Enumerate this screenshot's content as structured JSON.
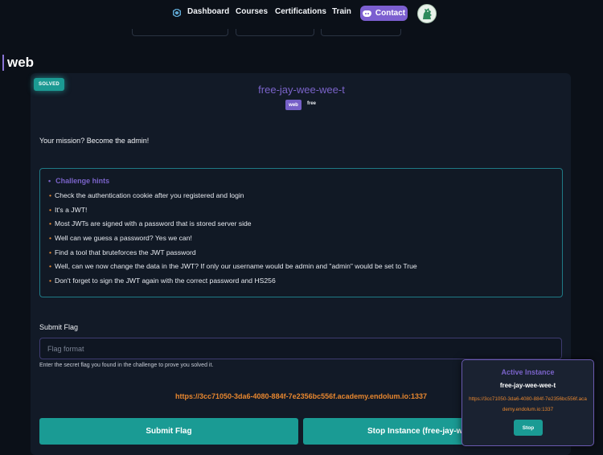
{
  "nav": {
    "items": [
      "Dashboard",
      "Courses",
      "Certifications",
      "Train"
    ],
    "contact_label": "Contact",
    "icons": {
      "logo": "hexagon-icon",
      "contact": "discord-icon",
      "avatar": "dragon-avatar"
    }
  },
  "category": {
    "title": "web"
  },
  "challenge": {
    "solved_badge": "SOLVED",
    "title": "free-jay-wee-wee-t",
    "tags": [
      "web",
      "free"
    ],
    "mission": "Your mission? Become the admin!",
    "hints_title": "Challenge hints",
    "hints": [
      "Check the authentication cookie after you registered and login",
      "It's a JWT!",
      "Most JWTs are signed with a password that is stored server side",
      "Well can we guess a password? Yes we can!",
      "Find a tool that bruteforces the JWT password",
      "Well, can we now change the data in the JWT? If only our username would be admin and \"admin\" would be set to True",
      "Don't forget to sign the JWT again with the correct password and HS256"
    ]
  },
  "flag_form": {
    "label": "Submit Flag",
    "placeholder": "Flag format",
    "value": "",
    "help": "Enter the secret flag you found in the challenge to prove you solved it.",
    "submit_label": "Submit Flag",
    "stop_label": "Stop Instance (free-jay-wee-wee-t)"
  },
  "instance_url": "https://3cc71050-3da6-4080-884f-7e2356bc556f.academy.endolum.io:1337",
  "active_instance": {
    "title": "Active Instance",
    "name": "free-jay-wee-wee-t",
    "url": "https://3cc71050-3da6-4080-884f-7e2356bc556f.academy.endolum.io:1337",
    "stop_label": "Stop"
  },
  "colors": {
    "background": "#0b1018",
    "card": "#121a27",
    "accent_purple": "#7a63c9",
    "accent_teal": "#1a9b94",
    "link_orange": "#e8872f"
  }
}
